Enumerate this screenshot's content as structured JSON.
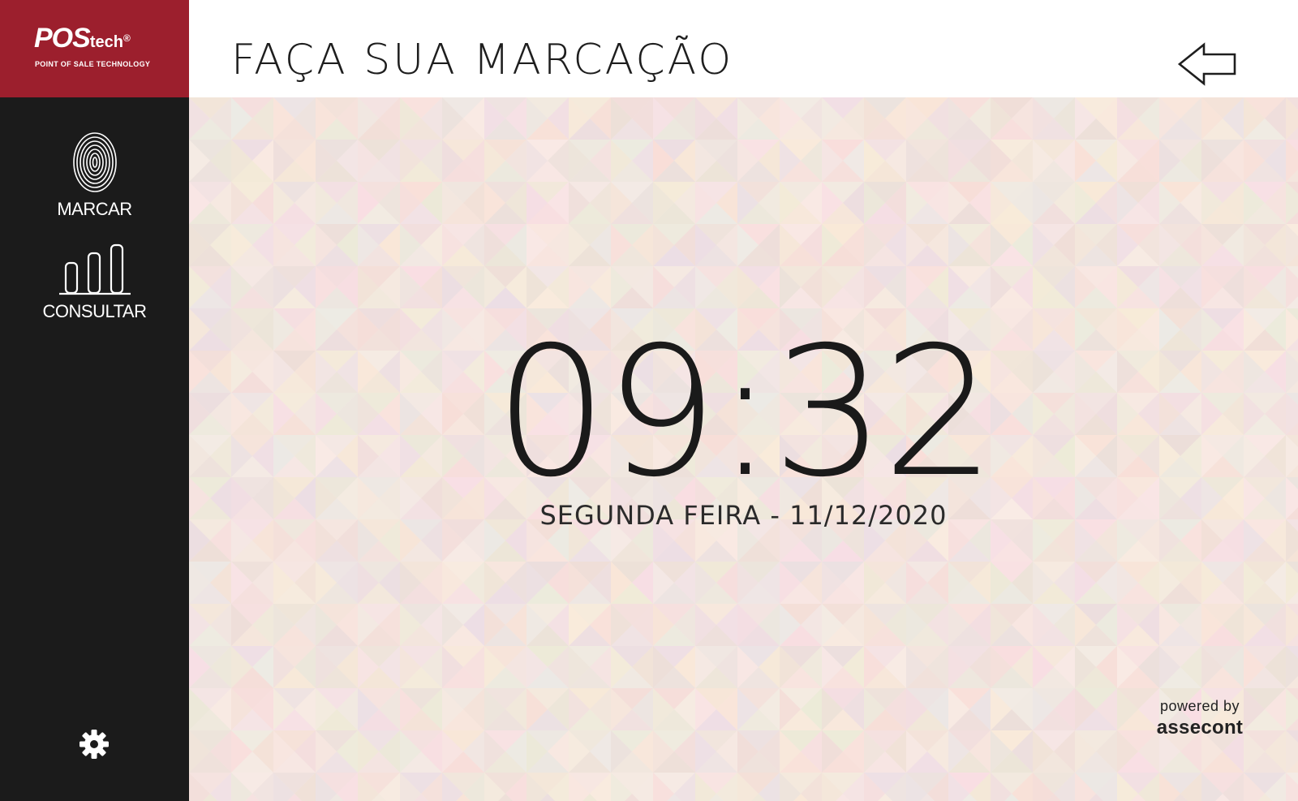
{
  "brand": {
    "logo_text": "POS",
    "logo_sub": "tech",
    "logo_reg": "®",
    "tagline": "POINT OF SALE TECHNOLOGY"
  },
  "header": {
    "title": "FAÇA SUA MARCAÇÃO"
  },
  "sidebar": {
    "items": [
      {
        "label": "MARCAR",
        "icon": "fingerprint-icon"
      },
      {
        "label": "CONSULTAR",
        "icon": "bar-chart-icon"
      }
    ],
    "settings_icon": "gear-icon"
  },
  "clock": {
    "time": "09:32",
    "date": "SEGUNDA FEIRA - 11/12/2020"
  },
  "footer": {
    "powered_by": "powered by",
    "company": "assecont"
  },
  "colors": {
    "brand_red": "#9c1f2d",
    "sidebar_bg": "#1b1b1b",
    "background": "#f3e6e0"
  }
}
